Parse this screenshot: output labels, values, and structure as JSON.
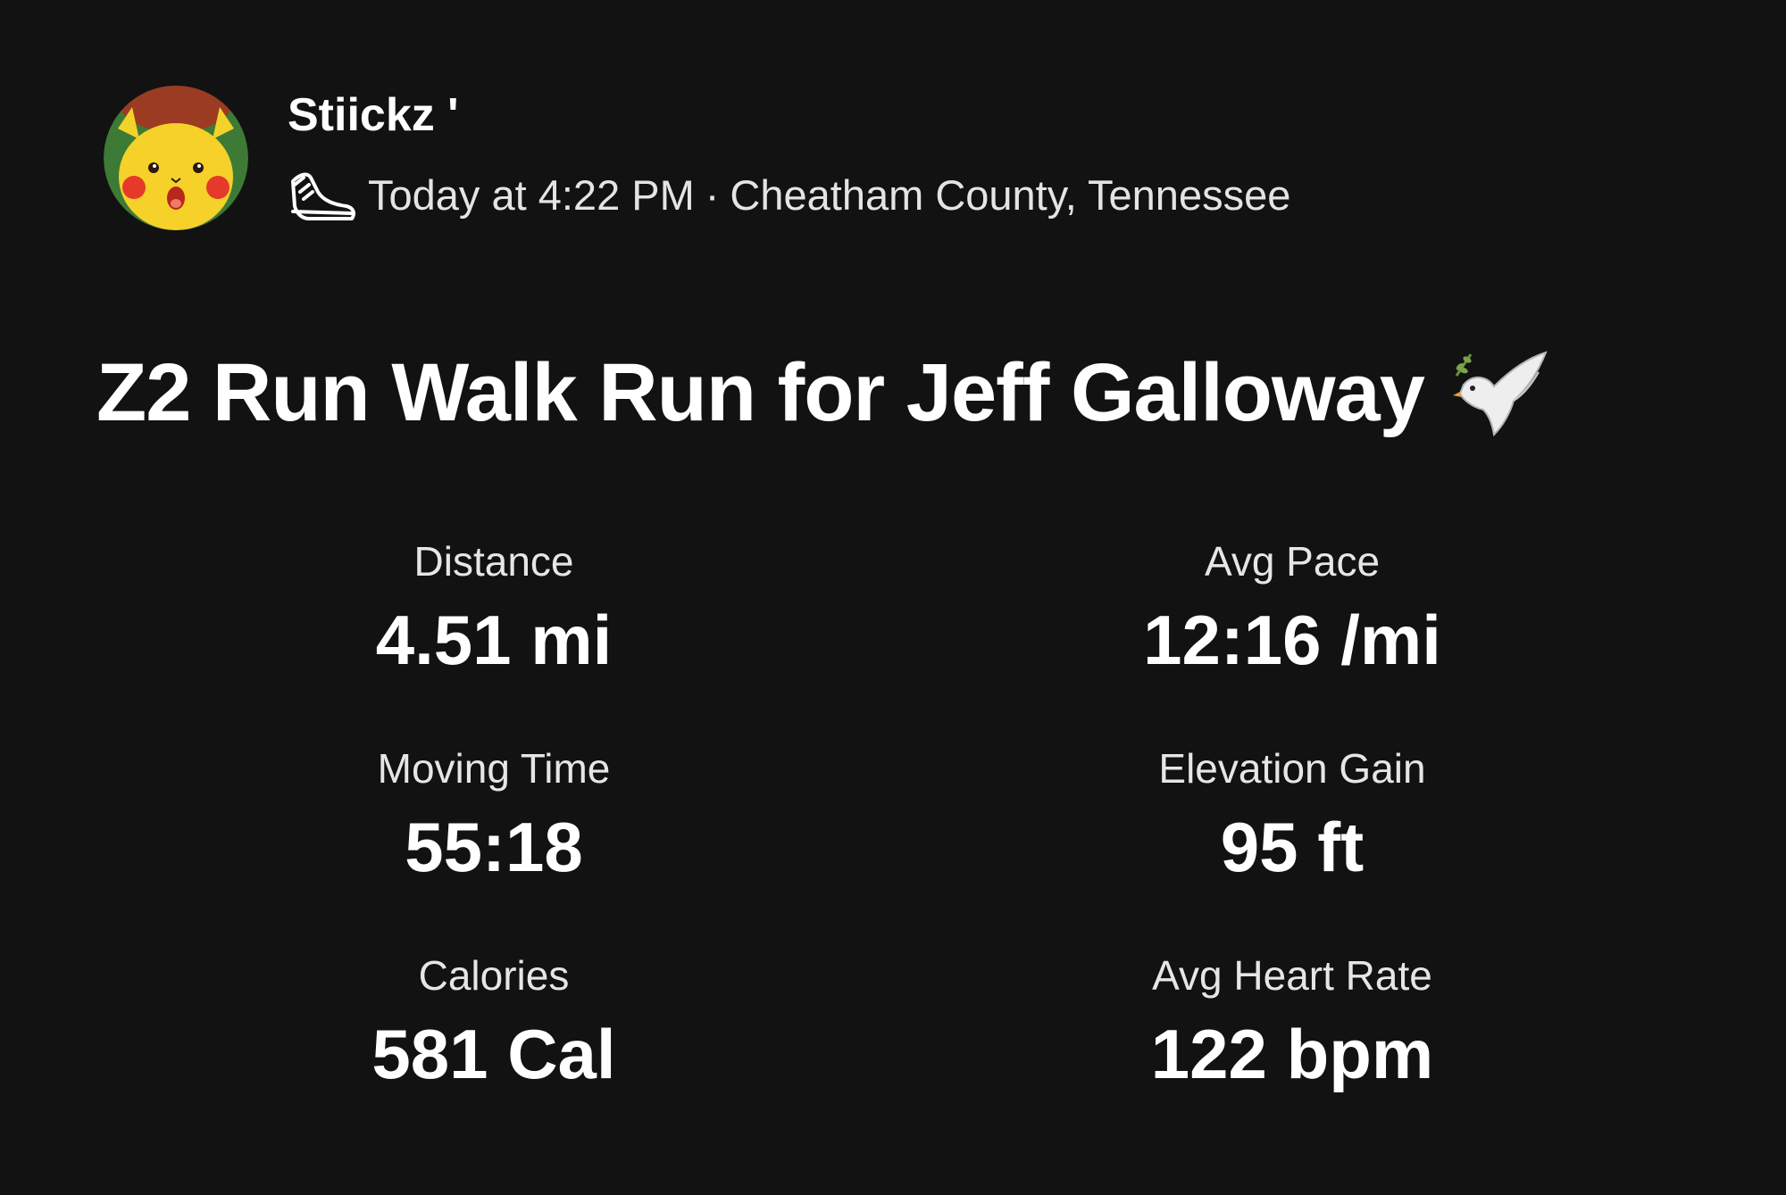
{
  "activity": {
    "athlete_name": "Stiickz '",
    "time": "Today at 4:22 PM",
    "separator": "·",
    "location": "Cheatham County, Tennessee",
    "title": "Z2 Run Walk Run for Jeff Galloway",
    "sport_icon": "running-shoe-icon",
    "title_emoji": "dove-icon"
  },
  "stats": [
    {
      "label": "Distance",
      "value": "4.51 mi"
    },
    {
      "label": "Avg Pace",
      "value": "12:16 /mi"
    },
    {
      "label": "Moving Time",
      "value": "55:18"
    },
    {
      "label": "Elevation Gain",
      "value": "95 ft"
    },
    {
      "label": "Calories",
      "value": "581 Cal"
    },
    {
      "label": "Avg Heart Rate",
      "value": "122 bpm"
    }
  ],
  "colors": {
    "background": "#121212",
    "text_primary": "#ffffff",
    "text_secondary": "#e4e4e4"
  }
}
